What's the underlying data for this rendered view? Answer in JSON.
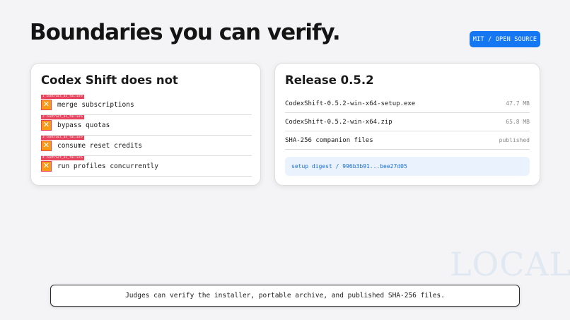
{
  "header": {
    "title": "Boundaries you can verify.",
    "badge": "MIT / OPEN SOURCE"
  },
  "does_not": {
    "title": "Codex Shift does not",
    "items": [
      {
        "tag": "1 contract_as_failure",
        "text": "merge subscriptions"
      },
      {
        "tag": "2 contract_as_failure",
        "text": "bypass quotas"
      },
      {
        "tag": "3 contract_as_failure",
        "text": "consume reset credits"
      },
      {
        "tag": "4 contract_as_failure",
        "text": "run profiles concurrently"
      }
    ],
    "icon": "x-mark-icon"
  },
  "release": {
    "title": "Release 0.5.2",
    "files": [
      {
        "name": "CodexShift-0.5.2-win-x64-setup.exe",
        "meta": "47.7 MB"
      },
      {
        "name": "CodexShift-0.5.2-win-x64.zip",
        "meta": "65.8 MB"
      },
      {
        "name": "SHA-256 companion files",
        "meta": "published"
      }
    ],
    "digest_label": "setup digest",
    "digest_sep": " / ",
    "digest_value": "996b3b91...bee27d05"
  },
  "watermark": "LOCAL",
  "footer": "Judges can verify the installer, portable archive, and published SHA-256 files.",
  "colors": {
    "accent": "#1677f2",
    "failure_tag": "#e8435d",
    "x_icon_fill": "#f79a16",
    "digest_bg": "#e9f2fd"
  }
}
